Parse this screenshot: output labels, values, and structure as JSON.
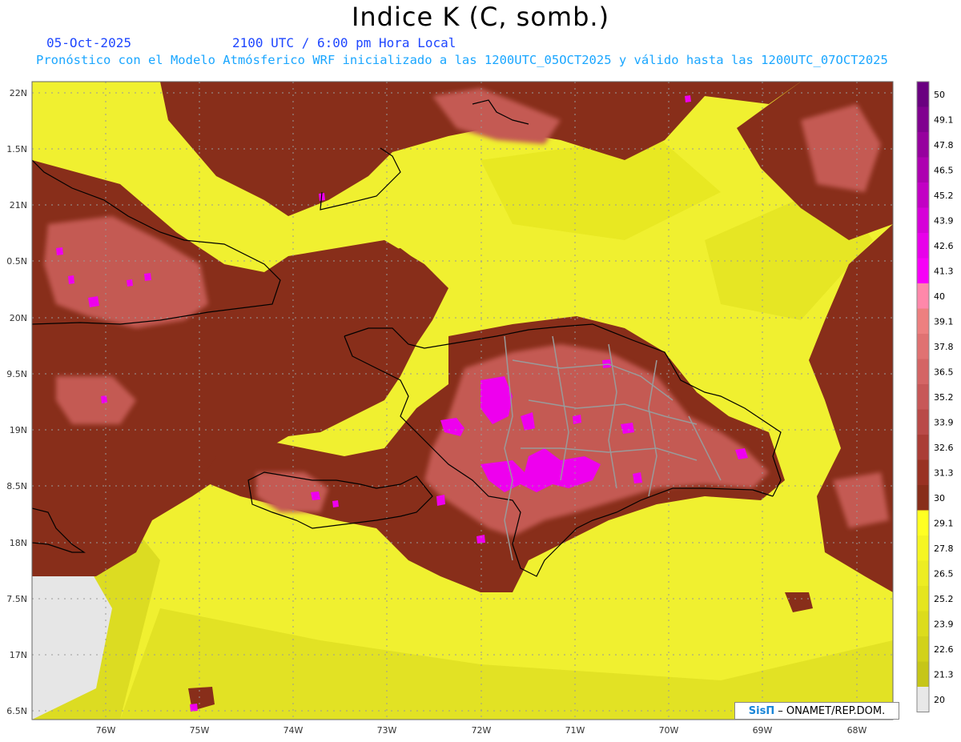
{
  "header": {
    "title": "Indice K (C, somb.)",
    "date": "05-Oct-2025",
    "time": "2100 UTC / 6:00 pm Hora Local",
    "description": "Pronóstico con el Modelo Atmósferico WRF inicializado a las 1200UTC_05OCT2025 y válido hasta las  1200UTC_07OCT2025"
  },
  "map": {
    "lat_labels": [
      "22N",
      "1.5N",
      "21N",
      "0.5N",
      "20N",
      "9.5N",
      "19N",
      "8.5N",
      "18N",
      "7.5N",
      "17N",
      "6.5N"
    ],
    "lon_labels": [
      "76W",
      "75W",
      "74W",
      "73W",
      "72W",
      "71W",
      "70W",
      "69W",
      "68W"
    ]
  },
  "colorbar": {
    "labels": [
      "50",
      "49.1",
      "47.8",
      "46.5",
      "45.2",
      "43.9",
      "42.6",
      "41.3",
      "40",
      "39.1",
      "37.8",
      "36.5",
      "35.2",
      "33.9",
      "32.6",
      "31.3",
      "30",
      "29.1",
      "27.8",
      "26.5",
      "25.2",
      "23.9",
      "22.6",
      "21.3",
      "20"
    ],
    "colors": [
      "#6a0080",
      "#80008f",
      "#96009e",
      "#ad00b0",
      "#c200c4",
      "#d600d8",
      "#e800ea",
      "#f700f7",
      "#ff88aa",
      "#ed8080",
      "#e07272",
      "#d46565",
      "#c75858",
      "#b94a48",
      "#aa3d36",
      "#993223",
      "#882e1a",
      "#ffff22",
      "#f5f522",
      "#eded22",
      "#e5e51e",
      "#dcdc1c",
      "#d2d21a",
      "#c6c618",
      "#e8e8e8"
    ]
  },
  "credit": {
    "logo": "SisΠ",
    "org": "ONAMET/REP.DOM."
  },
  "colors": {
    "brown": "#882e1a",
    "salmon": "#c75858",
    "yellow": "#ffff22",
    "magenta": "#ee00ee"
  }
}
